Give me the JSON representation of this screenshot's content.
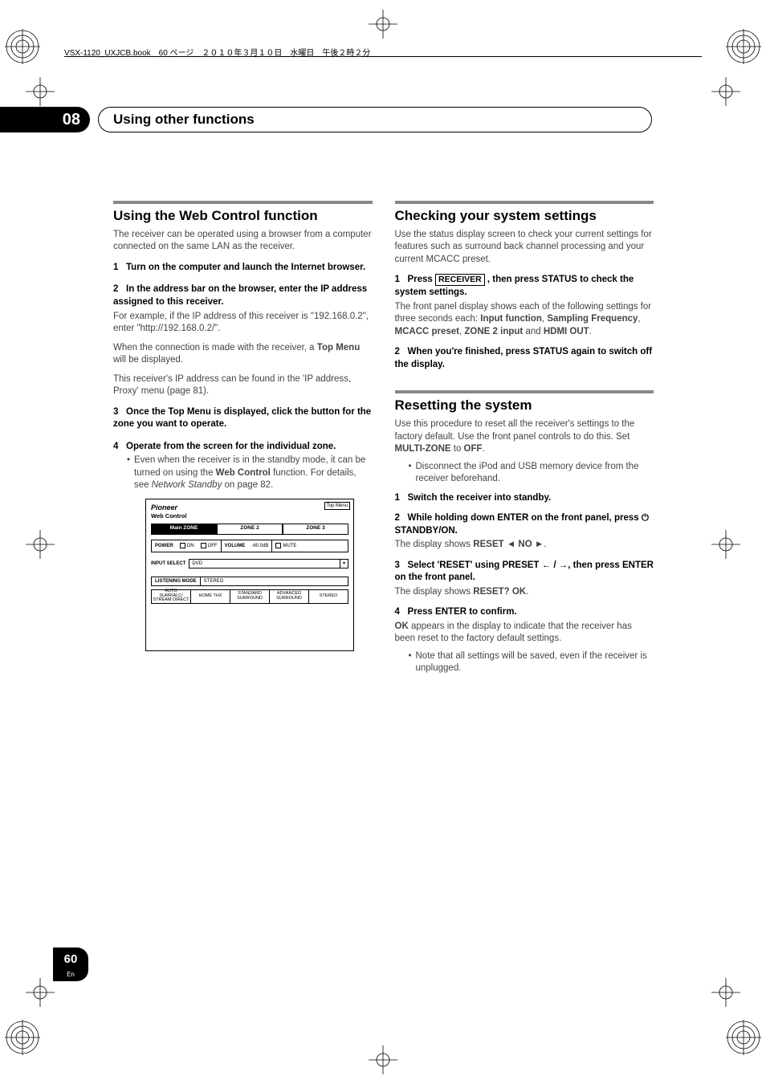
{
  "header": {
    "running": "VSX-1120_UXJCB.book　60 ページ　２０１０年３月１０日　水曜日　午後２時２分"
  },
  "chapter": {
    "number": "08",
    "title": "Using other functions"
  },
  "colL": {
    "h2": "Using the Web Control function",
    "intro": "The receiver can be operated using a browser from a computer connected on the same LAN as the receiver.",
    "s1n": "1",
    "s1t": "Turn on the computer and launch the Internet browser.",
    "s2n": "2",
    "s2t": "In the address bar on the browser, enter the IP address assigned to this receiver.",
    "s2b1": "For example, if the IP address of this receiver is \"192.168.0.2\", enter \"http://192.168.0.2/\".",
    "s2b2a": "When the connection is made with the receiver, a ",
    "s2b2bold": "Top Menu",
    "s2b2b": " will be displayed.",
    "s2b3": "This receiver's IP address can be found in the 'IP address, Proxy' menu (page 81).",
    "s3n": "3",
    "s3t": "Once the Top Menu is displayed, click the button for the zone you want to operate.",
    "s4n": "4",
    "s4t": "Operate from the screen for the individual zone.",
    "s4bul_a": "Even when the receiver is in the standby mode, it can be turned on using the ",
    "s4bul_bold": "Web Control",
    "s4bul_b": " function. For details, see ",
    "s4bul_ital": "Network Standby",
    "s4bul_c": " on page 82."
  },
  "screenshot": {
    "brand": "Pioneer",
    "help": "Top Menu",
    "title": "Web Control",
    "tab1": "Main ZONE",
    "tab2": "ZONE 2",
    "tab3": "ZONE 3",
    "power": "POWER",
    "on": "ON",
    "off": "OFF",
    "volume": "VOLUME",
    "db": "-60.0dB",
    "mute": "MUTE",
    "inputsel": "INPUT SELECT",
    "inputval": "DVD",
    "listenmode": "LISTENING MODE",
    "listenval": "STEREO",
    "b1": "AUTO SURR/ALC/\nSTREAM DIRECT",
    "b2": "HOME\nTHX",
    "b3": "STANDARD\nSURROUND",
    "b4": "ADVANCED\nSURROUND",
    "b5": "STEREO"
  },
  "colR": {
    "sec1": {
      "h2": "Checking your system settings",
      "intro": "Use the status display screen to check your current settings for features such as surround back channel processing and your current MCACC preset.",
      "s1n": "1",
      "s1a": "Press ",
      "s1key": "RECEIVER",
      "s1b": " , then press STATUS to check the system settings.",
      "s1ba": "The front panel display shows each of the following settings for three seconds each: ",
      "s1b_if": "Input function",
      "s1b_c1": ", ",
      "s1b_sf": "Sampling Frequency",
      "s1b_c2": ", ",
      "s1b_mp": "MCACC preset",
      "s1b_c3": ", ",
      "s1b_z2": "ZONE 2 input",
      "s1b_and": " and ",
      "s1b_ho": "HDMI OUT",
      "s1b_end": ".",
      "s2n": "2",
      "s2t": "When you're finished, press STATUS again to switch off the display."
    },
    "sec2": {
      "h2": "Resetting the system",
      "intro_a": "Use this procedure to reset all the receiver's settings to the factory default. Use the front panel controls to do this. Set ",
      "intro_bold": "MULTI-ZONE",
      "intro_b": " to ",
      "intro_bold2": "OFF",
      "intro_c": ".",
      "bul1": "Disconnect the iPod and USB memory device from the receiver beforehand.",
      "s1n": "1",
      "s1t": "Switch the receiver into standby.",
      "s2n": "2",
      "s2a": "While holding down ENTER on the front panel, press ",
      "s2pwr": "⏻",
      "s2b": " STANDBY/ON.",
      "s2body_a": "The display shows ",
      "s2body_bold": "RESET ◄ NO ►",
      "s2body_b": ".",
      "s3n": "3",
      "s3a": "Select 'RESET' using PRESET ",
      "s3arrows": "← / →",
      "s3b": ", then press ENTER on the front panel.",
      "s3body_a": "The display shows ",
      "s3body_bold": "RESET? OK",
      "s3body_b": ".",
      "s4n": "4",
      "s4t": "Press ENTER to confirm.",
      "s4body_a": "OK",
      "s4body_b": " appears in the display to indicate that the receiver has been reset to the factory default settings.",
      "bul2": "Note that all settings will be saved, even if the receiver is unplugged."
    }
  },
  "page": {
    "num": "60",
    "lang": "En"
  }
}
